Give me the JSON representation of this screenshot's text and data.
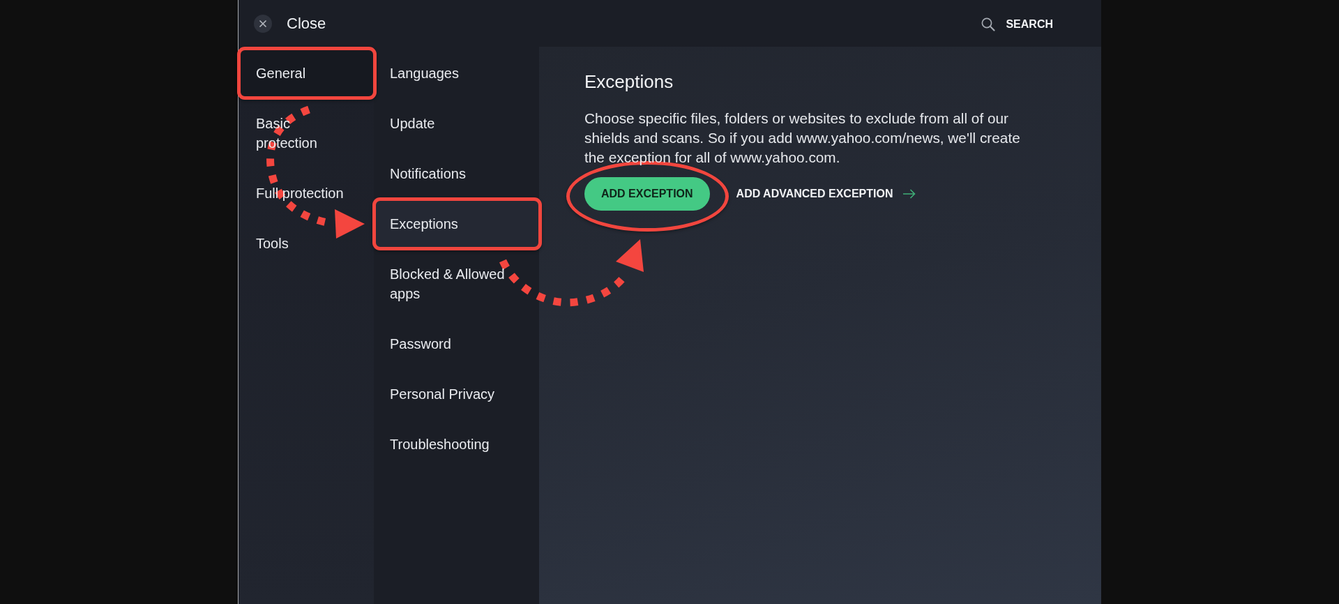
{
  "header": {
    "close": {
      "label": "Close"
    },
    "search": {
      "label": "SEARCH"
    }
  },
  "categories": [
    {
      "label": "General",
      "selected": true,
      "highlighted": true
    },
    {
      "label": "Basic protection",
      "selected": false,
      "highlighted": false
    },
    {
      "label": "Full protection",
      "selected": false,
      "highlighted": false
    },
    {
      "label": "Tools",
      "selected": false,
      "highlighted": false
    }
  ],
  "subcategories": [
    {
      "label": "Languages",
      "selected": false,
      "highlighted": false
    },
    {
      "label": "Update",
      "selected": false,
      "highlighted": false
    },
    {
      "label": "Notifications",
      "selected": false,
      "highlighted": false
    },
    {
      "label": "Exceptions",
      "selected": true,
      "highlighted": true
    },
    {
      "label": "Blocked & Allowed apps",
      "selected": false,
      "highlighted": false
    },
    {
      "label": "Password",
      "selected": false,
      "highlighted": false
    },
    {
      "label": "Personal Privacy",
      "selected": false,
      "highlighted": false
    },
    {
      "label": "Troubleshooting",
      "selected": false,
      "highlighted": false
    }
  ],
  "content": {
    "title": "Exceptions",
    "description": "Choose specific files, folders or websites to exclude from all of our shields and scans. So if you add www.yahoo.com/news, we'll create the exception for all of www.yahoo.com.",
    "primary_button": {
      "label": "ADD EXCEPTION",
      "highlighted": true
    },
    "link": {
      "label": "ADD ADVANCED EXCEPTION"
    }
  }
}
